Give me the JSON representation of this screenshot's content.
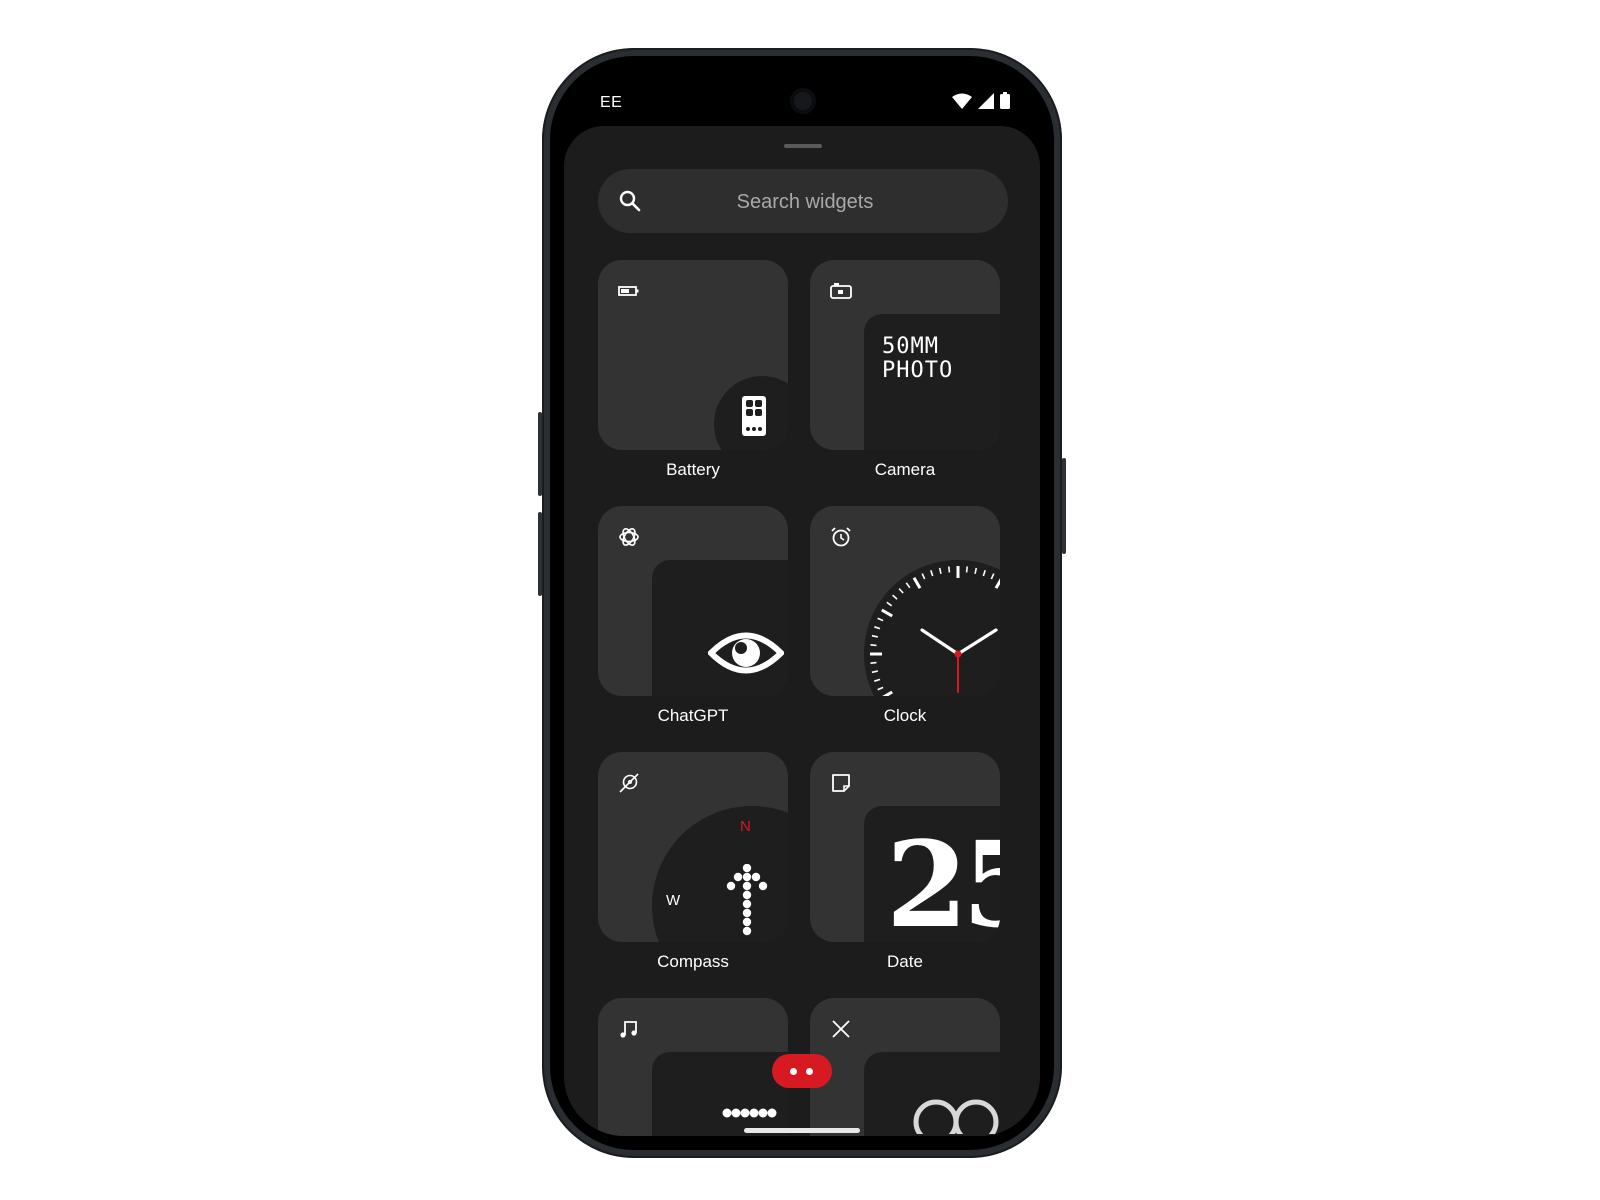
{
  "status_bar": {
    "carrier": "EE"
  },
  "search": {
    "placeholder": "Search widgets"
  },
  "widgets": [
    {
      "label": "Battery",
      "icon": "battery-icon"
    },
    {
      "label": "Camera",
      "icon": "camera-icon",
      "preview_text": [
        "50MM",
        "PHOTO"
      ]
    },
    {
      "label": "ChatGPT",
      "icon": "chatgpt-icon"
    },
    {
      "label": "Clock",
      "icon": "alarm-clock-icon"
    },
    {
      "label": "Compass",
      "icon": "compass-icon",
      "preview_text": [
        "N",
        "W"
      ]
    },
    {
      "label": "Date",
      "icon": "note-icon",
      "preview_text": "25"
    },
    {
      "label": "",
      "icon": "music-note-icon"
    },
    {
      "label": "",
      "icon": "x-icon"
    }
  ],
  "colors": {
    "accent": "#d71921",
    "sheet": "#1c1c1c",
    "card": "#333333",
    "inner": "#1e1e1e"
  }
}
